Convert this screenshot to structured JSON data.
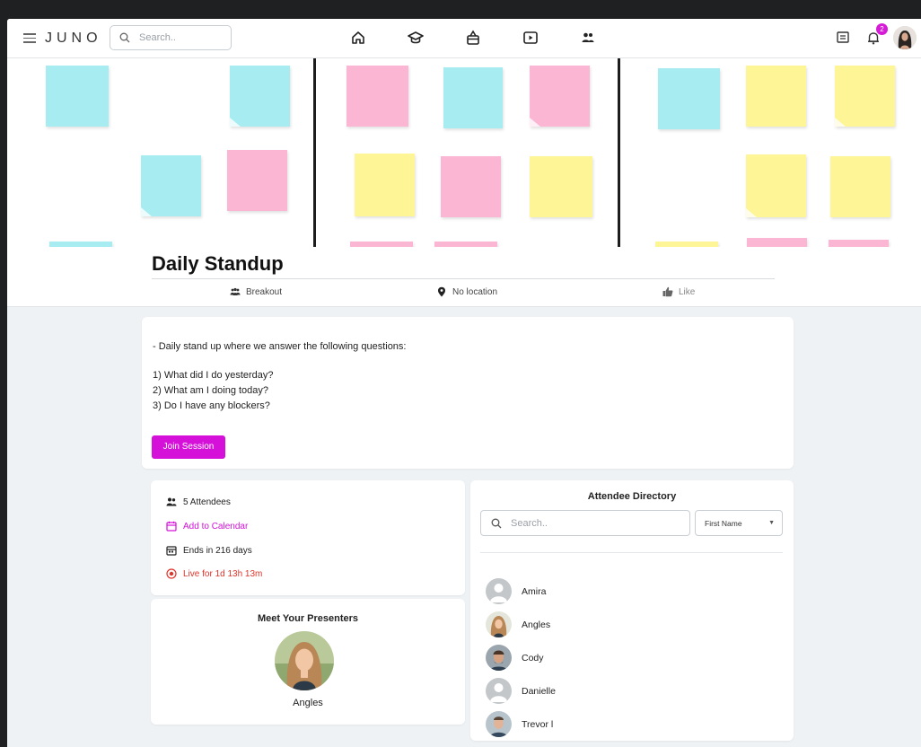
{
  "header": {
    "logo": "JUNO",
    "search_placeholder": "Search..",
    "nav_icons": [
      "home-icon",
      "graduation-cap-icon",
      "box-icon",
      "play-icon",
      "people-icon"
    ],
    "notification_count": "2"
  },
  "event": {
    "title": "Daily Standup",
    "type_label": "Breakout",
    "location_label": "No location",
    "like_label": "Like"
  },
  "description": {
    "lines": [
      "- Daily stand up where we answer the following questions:",
      "1) What did I do yesterday?",
      "2) What am I doing today?",
      "3) Do I have any blockers?"
    ],
    "join_label": "Join Session"
  },
  "info": {
    "attendees": "5 Attendees",
    "add_to_calendar": "Add to Calendar",
    "ends": "Ends in 216 days",
    "live": "Live for 1d 13h 13m"
  },
  "presenters": {
    "title": "Meet Your Presenters",
    "items": [
      {
        "name": "Angles"
      }
    ]
  },
  "directory": {
    "title": "Attendee Directory",
    "search_placeholder": "Search..",
    "sort_selected": "First Name",
    "attendees": [
      {
        "name": "Amira"
      },
      {
        "name": "Angles"
      },
      {
        "name": "Cody"
      },
      {
        "name": "Danielle"
      },
      {
        "name": "Trevor l"
      }
    ]
  },
  "colors": {
    "accent": "#d410d9",
    "live": "#e0342b",
    "background": "#eff2f4",
    "note_blue": "#a6ecf0",
    "note_pink": "#fbb6d3",
    "note_yellow": "#fdf596"
  }
}
